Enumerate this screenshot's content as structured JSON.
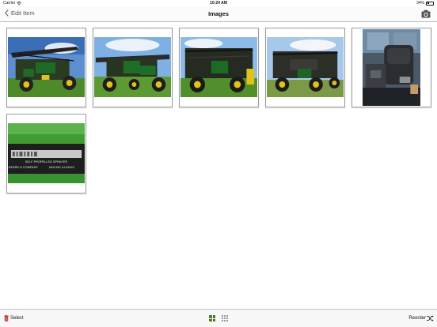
{
  "status_bar": {
    "carrier": "Carrier",
    "time": "10:24 AM",
    "battery": "34%",
    "battery_level": 0.34
  },
  "nav": {
    "back_label": "Edit Item",
    "title": "Images",
    "camera_icon": "camera-icon"
  },
  "images": [
    {
      "orientation": "landscape",
      "icon": "sprayer-photo"
    },
    {
      "orientation": "landscape",
      "icon": "sprayer-photo"
    },
    {
      "orientation": "landscape",
      "icon": "sprayer-photo"
    },
    {
      "orientation": "landscape",
      "icon": "sprayer-photo"
    },
    {
      "orientation": "portrait",
      "icon": "cab-interior-photo"
    },
    {
      "orientation": "landscape",
      "icon": "serial-plate-photo"
    }
  ],
  "serial_plate": {
    "line1": "SELF PROPELLED SPRAYER",
    "line2": "DEERE & COMPANY",
    "line3": "MOLINE ILLINOIS"
  },
  "toolbar": {
    "select_label": "Select",
    "reorder_label": "Reorder"
  },
  "colors": {
    "accent_green": "#4a7a2f",
    "trash_red": "#c0281e"
  }
}
